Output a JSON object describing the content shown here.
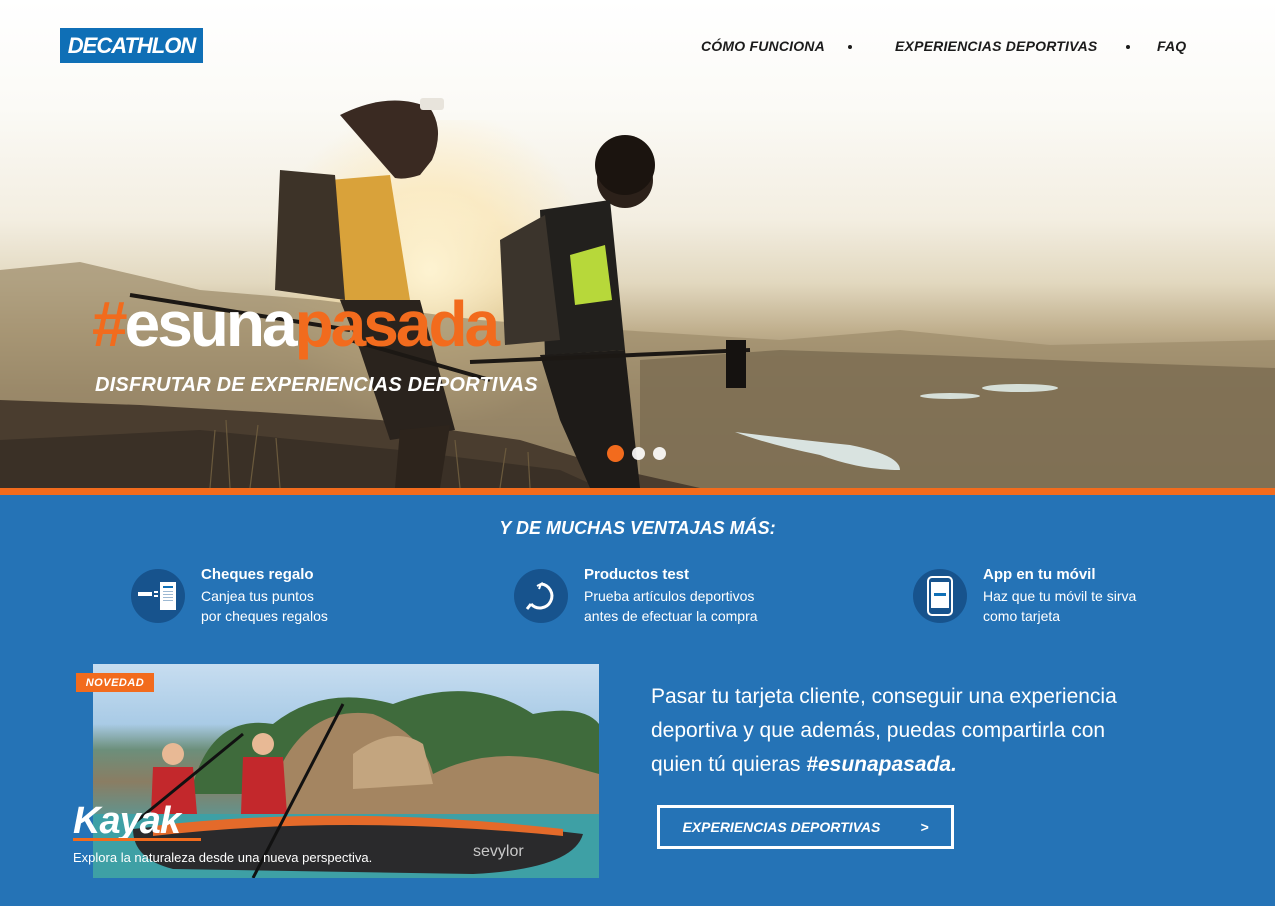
{
  "brand": {
    "logo_text": "DECATHLON",
    "blue": "#0f6fb6",
    "orange": "#f26b1d"
  },
  "nav": {
    "items": [
      {
        "label": "CÓMO FUNCIONA"
      },
      {
        "label": "EXPERIENCIAS DEPORTIVAS"
      },
      {
        "label": "FAQ"
      }
    ]
  },
  "hero": {
    "hashtag_symbol": "#",
    "hashtag_word1": "esuna",
    "hashtag_word2": "pasada",
    "subtitle": "DISFRUTAR DE EXPERIENCIAS DEPORTIVAS",
    "slides_total": 3,
    "active_slide": 1
  },
  "benefits": {
    "title": "Y DE MUCHAS VENTAJAS MÁS:",
    "items": [
      {
        "title": "Cheques regalo",
        "line1": "Canjea tus puntos",
        "line2": "por cheques regalos",
        "icon": "gift-check-icon"
      },
      {
        "title": "Productos test",
        "line1": "Prueba artículos deportivos",
        "line2": "antes de efectuar la compra",
        "icon": "test-product-icon"
      },
      {
        "title": "App en tu móvil",
        "line1": "Haz que tu móvil te sirva",
        "line2": "como tarjeta",
        "icon": "mobile-app-icon"
      }
    ]
  },
  "kayak": {
    "badge": "NOVEDAD",
    "title": "Kayak",
    "subtitle": "Explora la naturaleza desde una nueva perspectiva.",
    "brand_on_kayak": "sevylor"
  },
  "promo": {
    "text": "Pasar tu tarjeta cliente, conseguir una experiencia deportiva y que además, puedas compartirla con quien tú quieras ",
    "highlight": "#esunapasada."
  },
  "cta": {
    "label": "EXPERIENCIAS DEPORTIVAS",
    "arrow": ">"
  }
}
